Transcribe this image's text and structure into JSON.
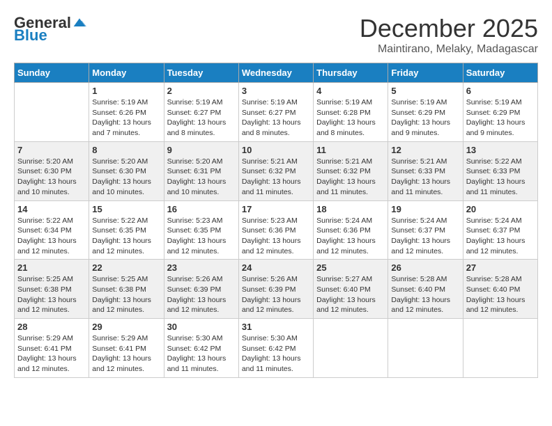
{
  "logo": {
    "general": "General",
    "blue": "Blue"
  },
  "title": "December 2025",
  "location": "Maintirano, Melaky, Madagascar",
  "headers": [
    "Sunday",
    "Monday",
    "Tuesday",
    "Wednesday",
    "Thursday",
    "Friday",
    "Saturday"
  ],
  "weeks": [
    [
      {
        "day": "",
        "info": ""
      },
      {
        "day": "1",
        "info": "Sunrise: 5:19 AM\nSunset: 6:26 PM\nDaylight: 13 hours\nand 7 minutes."
      },
      {
        "day": "2",
        "info": "Sunrise: 5:19 AM\nSunset: 6:27 PM\nDaylight: 13 hours\nand 8 minutes."
      },
      {
        "day": "3",
        "info": "Sunrise: 5:19 AM\nSunset: 6:27 PM\nDaylight: 13 hours\nand 8 minutes."
      },
      {
        "day": "4",
        "info": "Sunrise: 5:19 AM\nSunset: 6:28 PM\nDaylight: 13 hours\nand 8 minutes."
      },
      {
        "day": "5",
        "info": "Sunrise: 5:19 AM\nSunset: 6:29 PM\nDaylight: 13 hours\nand 9 minutes."
      },
      {
        "day": "6",
        "info": "Sunrise: 5:19 AM\nSunset: 6:29 PM\nDaylight: 13 hours\nand 9 minutes."
      }
    ],
    [
      {
        "day": "7",
        "info": "Sunrise: 5:20 AM\nSunset: 6:30 PM\nDaylight: 13 hours\nand 10 minutes."
      },
      {
        "day": "8",
        "info": "Sunrise: 5:20 AM\nSunset: 6:30 PM\nDaylight: 13 hours\nand 10 minutes."
      },
      {
        "day": "9",
        "info": "Sunrise: 5:20 AM\nSunset: 6:31 PM\nDaylight: 13 hours\nand 10 minutes."
      },
      {
        "day": "10",
        "info": "Sunrise: 5:21 AM\nSunset: 6:32 PM\nDaylight: 13 hours\nand 11 minutes."
      },
      {
        "day": "11",
        "info": "Sunrise: 5:21 AM\nSunset: 6:32 PM\nDaylight: 13 hours\nand 11 minutes."
      },
      {
        "day": "12",
        "info": "Sunrise: 5:21 AM\nSunset: 6:33 PM\nDaylight: 13 hours\nand 11 minutes."
      },
      {
        "day": "13",
        "info": "Sunrise: 5:22 AM\nSunset: 6:33 PM\nDaylight: 13 hours\nand 11 minutes."
      }
    ],
    [
      {
        "day": "14",
        "info": "Sunrise: 5:22 AM\nSunset: 6:34 PM\nDaylight: 13 hours\nand 12 minutes."
      },
      {
        "day": "15",
        "info": "Sunrise: 5:22 AM\nSunset: 6:35 PM\nDaylight: 13 hours\nand 12 minutes."
      },
      {
        "day": "16",
        "info": "Sunrise: 5:23 AM\nSunset: 6:35 PM\nDaylight: 13 hours\nand 12 minutes."
      },
      {
        "day": "17",
        "info": "Sunrise: 5:23 AM\nSunset: 6:36 PM\nDaylight: 13 hours\nand 12 minutes."
      },
      {
        "day": "18",
        "info": "Sunrise: 5:24 AM\nSunset: 6:36 PM\nDaylight: 13 hours\nand 12 minutes."
      },
      {
        "day": "19",
        "info": "Sunrise: 5:24 AM\nSunset: 6:37 PM\nDaylight: 13 hours\nand 12 minutes."
      },
      {
        "day": "20",
        "info": "Sunrise: 5:24 AM\nSunset: 6:37 PM\nDaylight: 13 hours\nand 12 minutes."
      }
    ],
    [
      {
        "day": "21",
        "info": "Sunrise: 5:25 AM\nSunset: 6:38 PM\nDaylight: 13 hours\nand 12 minutes."
      },
      {
        "day": "22",
        "info": "Sunrise: 5:25 AM\nSunset: 6:38 PM\nDaylight: 13 hours\nand 12 minutes."
      },
      {
        "day": "23",
        "info": "Sunrise: 5:26 AM\nSunset: 6:39 PM\nDaylight: 13 hours\nand 12 minutes."
      },
      {
        "day": "24",
        "info": "Sunrise: 5:26 AM\nSunset: 6:39 PM\nDaylight: 13 hours\nand 12 minutes."
      },
      {
        "day": "25",
        "info": "Sunrise: 5:27 AM\nSunset: 6:40 PM\nDaylight: 13 hours\nand 12 minutes."
      },
      {
        "day": "26",
        "info": "Sunrise: 5:28 AM\nSunset: 6:40 PM\nDaylight: 13 hours\nand 12 minutes."
      },
      {
        "day": "27",
        "info": "Sunrise: 5:28 AM\nSunset: 6:40 PM\nDaylight: 13 hours\nand 12 minutes."
      }
    ],
    [
      {
        "day": "28",
        "info": "Sunrise: 5:29 AM\nSunset: 6:41 PM\nDaylight: 13 hours\nand 12 minutes."
      },
      {
        "day": "29",
        "info": "Sunrise: 5:29 AM\nSunset: 6:41 PM\nDaylight: 13 hours\nand 12 minutes."
      },
      {
        "day": "30",
        "info": "Sunrise: 5:30 AM\nSunset: 6:42 PM\nDaylight: 13 hours\nand 11 minutes."
      },
      {
        "day": "31",
        "info": "Sunrise: 5:30 AM\nSunset: 6:42 PM\nDaylight: 13 hours\nand 11 minutes."
      },
      {
        "day": "",
        "info": ""
      },
      {
        "day": "",
        "info": ""
      },
      {
        "day": "",
        "info": ""
      }
    ]
  ]
}
